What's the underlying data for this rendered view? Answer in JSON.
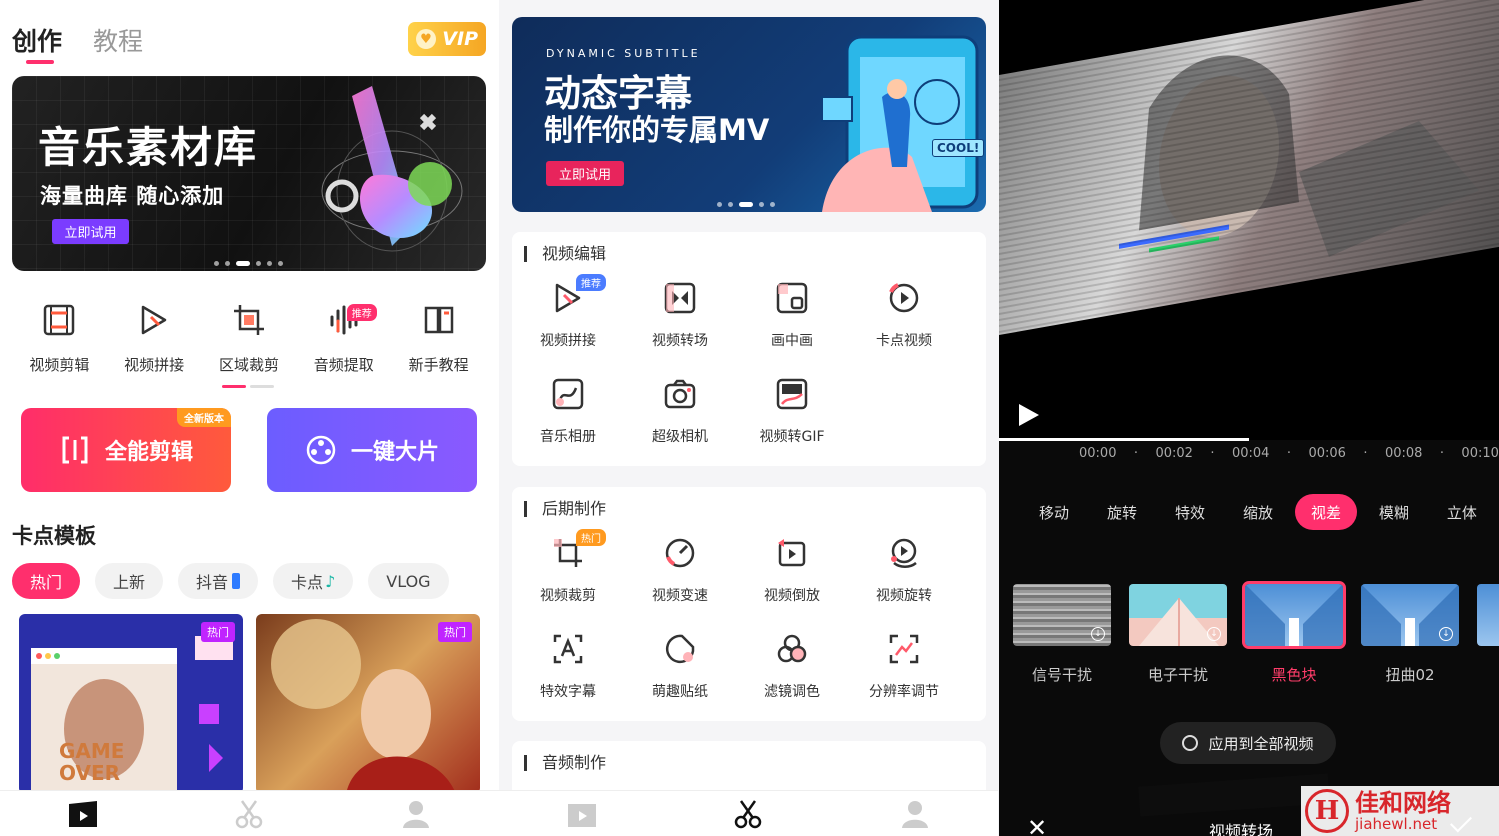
{
  "panel1": {
    "tabs": [
      {
        "label": "创作"
      },
      {
        "label": "教程"
      }
    ],
    "vip": "VIP",
    "banner": {
      "title": "音乐素材库",
      "subtitle": "海量曲库 随心添加",
      "button": "立即试用"
    },
    "features": [
      {
        "label": "视频剪辑",
        "icon": "film-icon"
      },
      {
        "label": "视频拼接",
        "icon": "splice-icon"
      },
      {
        "label": "区域裁剪",
        "icon": "crop-icon"
      },
      {
        "label": "音频提取",
        "icon": "audio-wave-icon",
        "tag": "推荐"
      },
      {
        "label": "新手教程",
        "icon": "book-icon"
      }
    ],
    "actions": [
      {
        "label": "全能剪辑",
        "tag": "全新版本"
      },
      {
        "label": "一键大片"
      }
    ],
    "section_title": "卡点模板",
    "chips": [
      {
        "label": "热门"
      },
      {
        "label": "上新"
      },
      {
        "label": "抖音"
      },
      {
        "label": "卡点"
      },
      {
        "label": "VLOG"
      }
    ],
    "cards": [
      {
        "tag": "热门",
        "overlay": "GAME OVER"
      },
      {
        "tag": "热门"
      }
    ]
  },
  "panel2": {
    "banner": {
      "caption": "DYNAMIC SUBTITLE",
      "title": "动态字幕",
      "subtitle": "制作你的专属MV",
      "button": "立即试用",
      "screen_text": "COOL!"
    },
    "groups": [
      {
        "title": "视频编辑",
        "tools": [
          {
            "label": "视频拼接",
            "icon": "splice-icon",
            "tag": "推荐"
          },
          {
            "label": "视频转场",
            "icon": "transition-icon"
          },
          {
            "label": "画中画",
            "icon": "picture-in-picture-icon"
          },
          {
            "label": "卡点视频",
            "icon": "beat-video-icon"
          },
          {
            "label": "音乐相册",
            "icon": "music-album-icon"
          },
          {
            "label": "超级相机",
            "icon": "camera-icon"
          },
          {
            "label": "视频转GIF",
            "icon": "gif-icon"
          }
        ]
      },
      {
        "title": "后期制作",
        "tools": [
          {
            "label": "视频裁剪",
            "icon": "crop-icon",
            "tag": "热门"
          },
          {
            "label": "视频变速",
            "icon": "speed-icon"
          },
          {
            "label": "视频倒放",
            "icon": "reverse-icon"
          },
          {
            "label": "视频旋转",
            "icon": "rotate-icon"
          },
          {
            "label": "特效字幕",
            "icon": "subtitle-icon"
          },
          {
            "label": "萌趣贴纸",
            "icon": "sticker-icon"
          },
          {
            "label": "滤镜调色",
            "icon": "filter-icon"
          },
          {
            "label": "分辨率调节",
            "icon": "resolution-icon"
          }
        ]
      },
      {
        "title": "音频制作",
        "tools": []
      }
    ]
  },
  "panel3": {
    "timeline": [
      "00:00",
      "00:02",
      "00:04",
      "00:06",
      "00:08",
      "00:10"
    ],
    "progress_fraction": 0.5,
    "tabs": [
      {
        "label": "移动"
      },
      {
        "label": "旋转"
      },
      {
        "label": "特效"
      },
      {
        "label": "缩放"
      },
      {
        "label": "视差"
      },
      {
        "label": "模糊"
      },
      {
        "label": "立体"
      }
    ],
    "selected_tab": "视差",
    "effects": [
      {
        "label": "信号干扰"
      },
      {
        "label": "电子干扰"
      },
      {
        "label": "黑色块"
      },
      {
        "label": "扭曲02"
      }
    ],
    "selected_effect": "黑色块",
    "apply_label": "应用到全部视频",
    "title": "视频转场",
    "watermark": {
      "logo": "H",
      "name": "佳和网络",
      "url": "jiahewl.net"
    }
  },
  "colors": {
    "accent": "#ff2f6d",
    "purple": "#7b5cff",
    "dark": "#0a0a0a"
  }
}
